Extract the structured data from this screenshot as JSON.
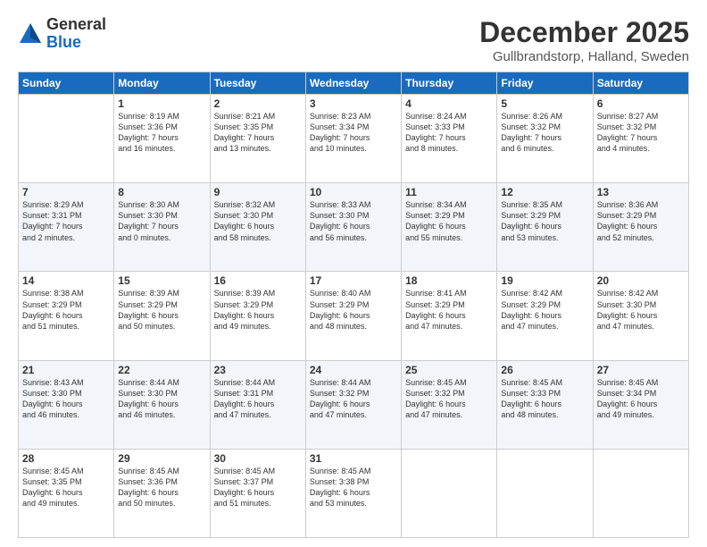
{
  "header": {
    "logo_general": "General",
    "logo_blue": "Blue",
    "month_title": "December 2025",
    "location": "Gullbrandstorp, Halland, Sweden"
  },
  "columns": [
    "Sunday",
    "Monday",
    "Tuesday",
    "Wednesday",
    "Thursday",
    "Friday",
    "Saturday"
  ],
  "weeks": [
    [
      {
        "day": "",
        "info": ""
      },
      {
        "day": "1",
        "info": "Sunrise: 8:19 AM\nSunset: 3:36 PM\nDaylight: 7 hours\nand 16 minutes."
      },
      {
        "day": "2",
        "info": "Sunrise: 8:21 AM\nSunset: 3:35 PM\nDaylight: 7 hours\nand 13 minutes."
      },
      {
        "day": "3",
        "info": "Sunrise: 8:23 AM\nSunset: 3:34 PM\nDaylight: 7 hours\nand 10 minutes."
      },
      {
        "day": "4",
        "info": "Sunrise: 8:24 AM\nSunset: 3:33 PM\nDaylight: 7 hours\nand 8 minutes."
      },
      {
        "day": "5",
        "info": "Sunrise: 8:26 AM\nSunset: 3:32 PM\nDaylight: 7 hours\nand 6 minutes."
      },
      {
        "day": "6",
        "info": "Sunrise: 8:27 AM\nSunset: 3:32 PM\nDaylight: 7 hours\nand 4 minutes."
      }
    ],
    [
      {
        "day": "7",
        "info": "Sunrise: 8:29 AM\nSunset: 3:31 PM\nDaylight: 7 hours\nand 2 minutes."
      },
      {
        "day": "8",
        "info": "Sunrise: 8:30 AM\nSunset: 3:30 PM\nDaylight: 7 hours\nand 0 minutes."
      },
      {
        "day": "9",
        "info": "Sunrise: 8:32 AM\nSunset: 3:30 PM\nDaylight: 6 hours\nand 58 minutes."
      },
      {
        "day": "10",
        "info": "Sunrise: 8:33 AM\nSunset: 3:30 PM\nDaylight: 6 hours\nand 56 minutes."
      },
      {
        "day": "11",
        "info": "Sunrise: 8:34 AM\nSunset: 3:29 PM\nDaylight: 6 hours\nand 55 minutes."
      },
      {
        "day": "12",
        "info": "Sunrise: 8:35 AM\nSunset: 3:29 PM\nDaylight: 6 hours\nand 53 minutes."
      },
      {
        "day": "13",
        "info": "Sunrise: 8:36 AM\nSunset: 3:29 PM\nDaylight: 6 hours\nand 52 minutes."
      }
    ],
    [
      {
        "day": "14",
        "info": "Sunrise: 8:38 AM\nSunset: 3:29 PM\nDaylight: 6 hours\nand 51 minutes."
      },
      {
        "day": "15",
        "info": "Sunrise: 8:39 AM\nSunset: 3:29 PM\nDaylight: 6 hours\nand 50 minutes."
      },
      {
        "day": "16",
        "info": "Sunrise: 8:39 AM\nSunset: 3:29 PM\nDaylight: 6 hours\nand 49 minutes."
      },
      {
        "day": "17",
        "info": "Sunrise: 8:40 AM\nSunset: 3:29 PM\nDaylight: 6 hours\nand 48 minutes."
      },
      {
        "day": "18",
        "info": "Sunrise: 8:41 AM\nSunset: 3:29 PM\nDaylight: 6 hours\nand 47 minutes."
      },
      {
        "day": "19",
        "info": "Sunrise: 8:42 AM\nSunset: 3:29 PM\nDaylight: 6 hours\nand 47 minutes."
      },
      {
        "day": "20",
        "info": "Sunrise: 8:42 AM\nSunset: 3:30 PM\nDaylight: 6 hours\nand 47 minutes."
      }
    ],
    [
      {
        "day": "21",
        "info": "Sunrise: 8:43 AM\nSunset: 3:30 PM\nDaylight: 6 hours\nand 46 minutes."
      },
      {
        "day": "22",
        "info": "Sunrise: 8:44 AM\nSunset: 3:30 PM\nDaylight: 6 hours\nand 46 minutes."
      },
      {
        "day": "23",
        "info": "Sunrise: 8:44 AM\nSunset: 3:31 PM\nDaylight: 6 hours\nand 47 minutes."
      },
      {
        "day": "24",
        "info": "Sunrise: 8:44 AM\nSunset: 3:32 PM\nDaylight: 6 hours\nand 47 minutes."
      },
      {
        "day": "25",
        "info": "Sunrise: 8:45 AM\nSunset: 3:32 PM\nDaylight: 6 hours\nand 47 minutes."
      },
      {
        "day": "26",
        "info": "Sunrise: 8:45 AM\nSunset: 3:33 PM\nDaylight: 6 hours\nand 48 minutes."
      },
      {
        "day": "27",
        "info": "Sunrise: 8:45 AM\nSunset: 3:34 PM\nDaylight: 6 hours\nand 49 minutes."
      }
    ],
    [
      {
        "day": "28",
        "info": "Sunrise: 8:45 AM\nSunset: 3:35 PM\nDaylight: 6 hours\nand 49 minutes."
      },
      {
        "day": "29",
        "info": "Sunrise: 8:45 AM\nSunset: 3:36 PM\nDaylight: 6 hours\nand 50 minutes."
      },
      {
        "day": "30",
        "info": "Sunrise: 8:45 AM\nSunset: 3:37 PM\nDaylight: 6 hours\nand 51 minutes."
      },
      {
        "day": "31",
        "info": "Sunrise: 8:45 AM\nSunset: 3:38 PM\nDaylight: 6 hours\nand 53 minutes."
      },
      {
        "day": "",
        "info": ""
      },
      {
        "day": "",
        "info": ""
      },
      {
        "day": "",
        "info": ""
      }
    ]
  ]
}
